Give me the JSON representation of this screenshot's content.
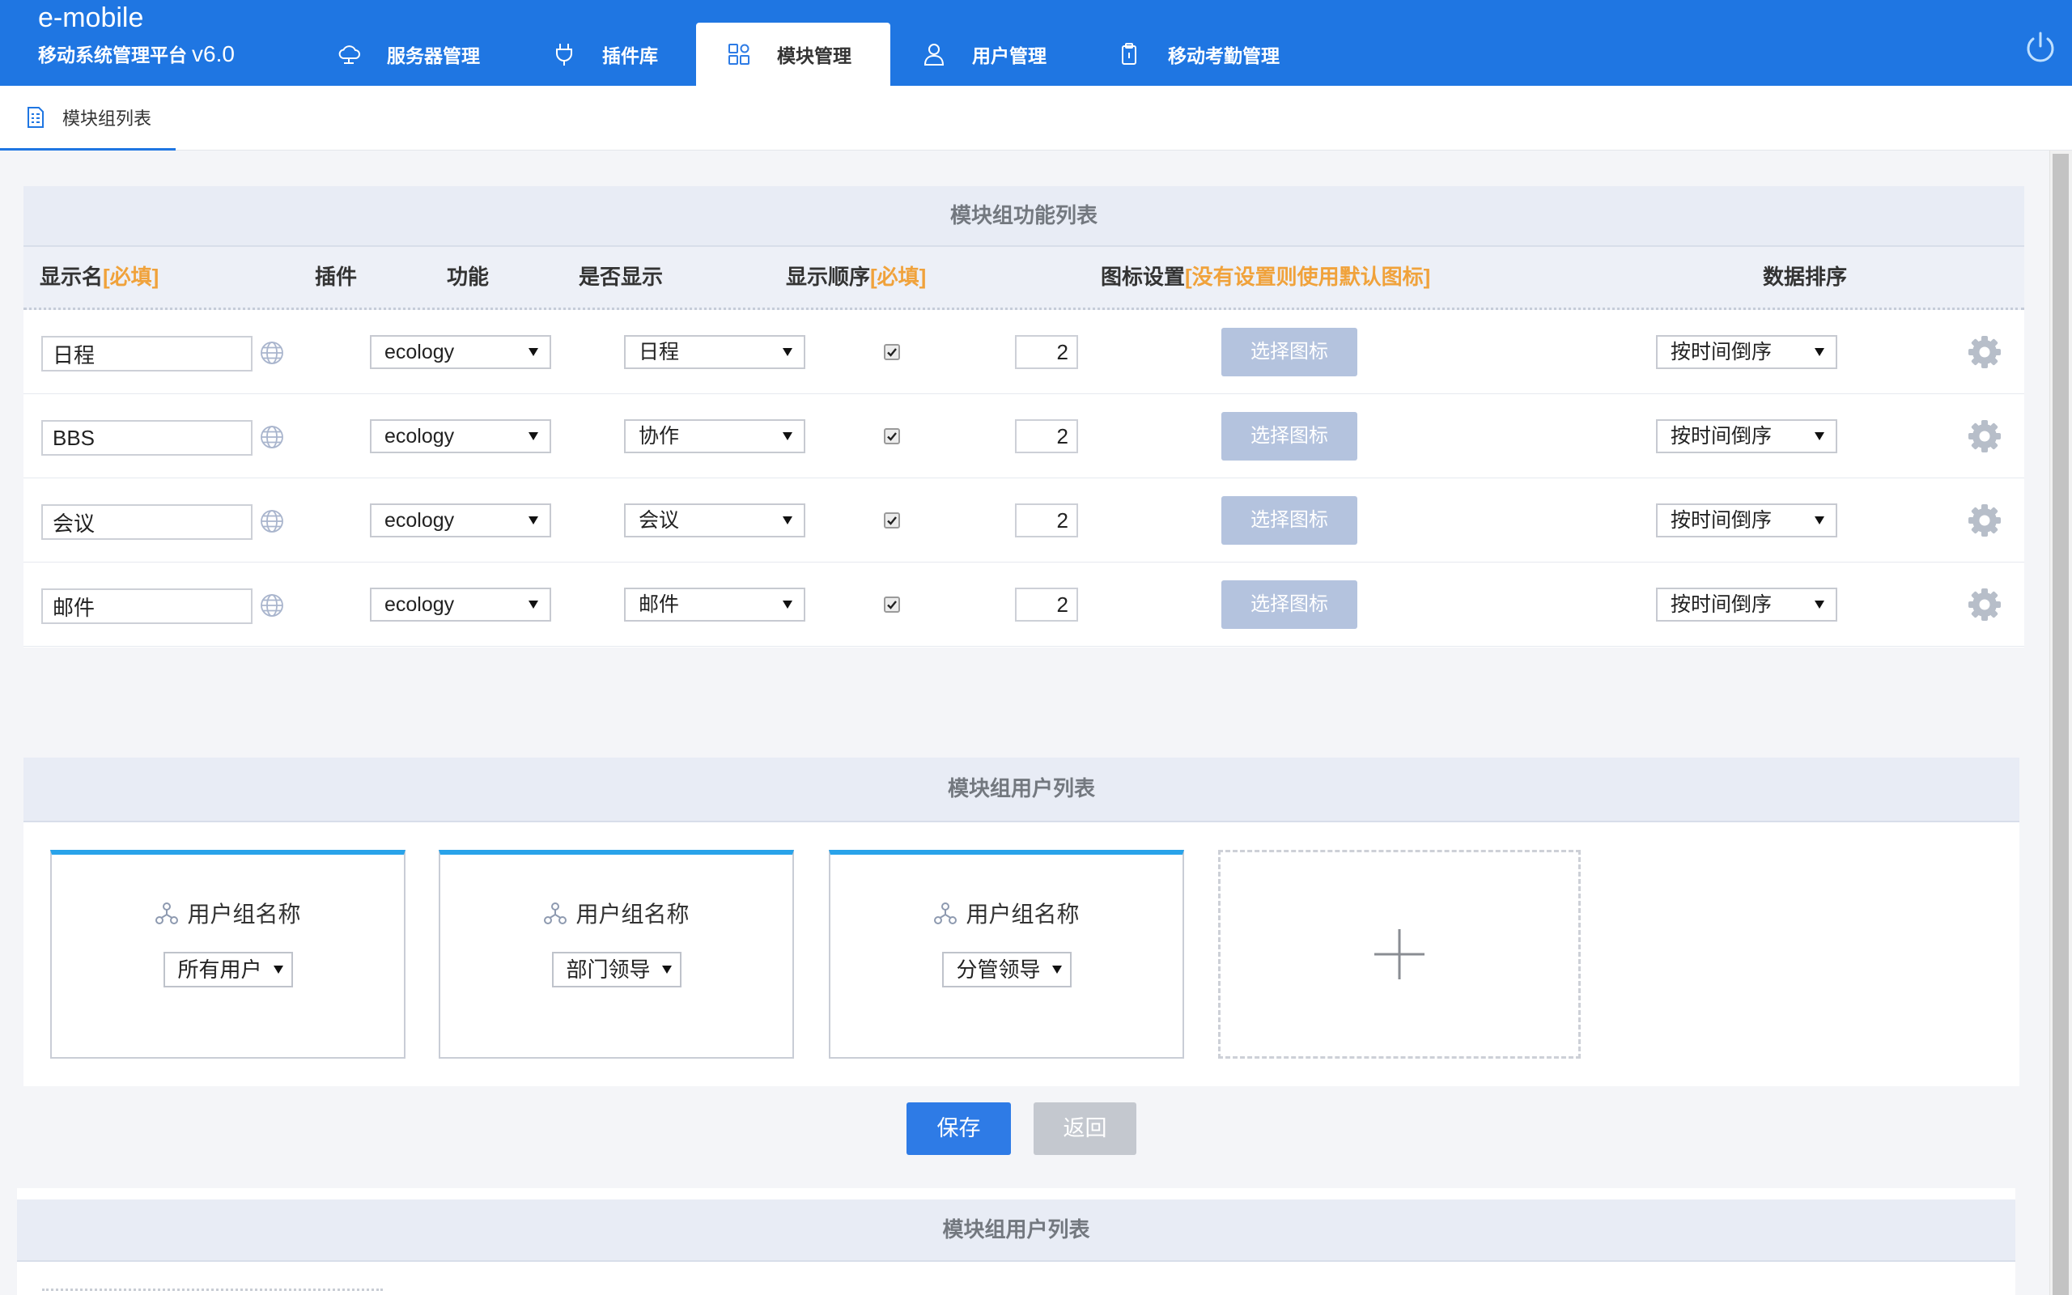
{
  "app": {
    "name": "e-mobile",
    "subtitle": "移动系统管理平台",
    "version": "v6.0"
  },
  "nav": {
    "tabs": [
      {
        "label": "服务器管理",
        "icon": "cloud-icon"
      },
      {
        "label": "插件库",
        "icon": "plug-icon"
      },
      {
        "label": "模块管理",
        "icon": "module-icon",
        "active": true
      },
      {
        "label": "用户管理",
        "icon": "user-icon"
      },
      {
        "label": "移动考勤管理",
        "icon": "clipboard-icon"
      }
    ],
    "power_icon": "power-icon"
  },
  "subnav": {
    "tabs": [
      {
        "label": "模块组列表",
        "icon": "document-list-icon",
        "active": true
      }
    ]
  },
  "function_panel": {
    "title": "模块组功能列表",
    "columns": {
      "name": "显示名",
      "name_required": "[必填]",
      "plugin": "插件",
      "function": "功能",
      "visible": "是否显示",
      "order": "显示顺序",
      "order_required": "[必填]",
      "icon": "图标设置",
      "icon_note": "[没有设置则使用默认图标]",
      "sort": "数据排序"
    },
    "rows": [
      {
        "name": "日程",
        "plugin": "ecology",
        "function": "日程",
        "visible": true,
        "order": "2",
        "icon_button": "选择图标",
        "sort": "按时间倒序"
      },
      {
        "name": "BBS",
        "plugin": "ecology",
        "function": "协作",
        "visible": true,
        "order": "2",
        "icon_button": "选择图标",
        "sort": "按时间倒序"
      },
      {
        "name": "会议",
        "plugin": "ecology",
        "function": "会议",
        "visible": true,
        "order": "2",
        "icon_button": "选择图标",
        "sort": "按时间倒序"
      },
      {
        "name": "邮件",
        "plugin": "ecology",
        "function": "邮件",
        "visible": true,
        "order": "2",
        "icon_button": "选择图标",
        "sort": "按时间倒序"
      }
    ]
  },
  "user_panel": {
    "title": "模块组用户列表",
    "groups": [
      {
        "label": "用户组名称",
        "value": "所有用户"
      },
      {
        "label": "用户组名称",
        "value": "部门领导"
      },
      {
        "label": "用户组名称",
        "value": "分管领导"
      }
    ],
    "add_icon": "plus-icon"
  },
  "actions": {
    "save": "保存",
    "back": "返回"
  },
  "bottom_panel": {
    "title": "模块组用户列表"
  },
  "colors": {
    "header": "#1f76e2",
    "required": "#f0a23b",
    "card_accent": "#29a3ea",
    "save": "#2e7be6",
    "back": "#c4c8cf",
    "icon_button": "#b4c3de"
  }
}
